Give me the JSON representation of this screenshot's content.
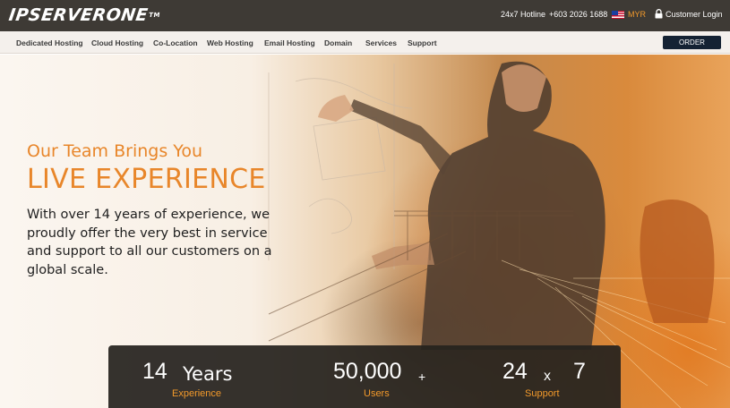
{
  "header": {
    "logo": "IPSERVERONE",
    "logo_tm": "TM",
    "hotline_label": "24x7 Hotline",
    "hotline_number": "+603 2026 1688",
    "currency": "MYR",
    "login_label": "Customer Login"
  },
  "nav": {
    "items": [
      {
        "label": "Dedicated Hosting"
      },
      {
        "label": "Cloud Hosting"
      },
      {
        "label": "Co-Location"
      },
      {
        "label": "Web Hosting"
      },
      {
        "label": "Email Hosting"
      },
      {
        "label": "Domain"
      },
      {
        "label": "Services"
      },
      {
        "label": "Support"
      }
    ],
    "order_label": "ORDER"
  },
  "hero": {
    "subtitle": "Our Team Brings You",
    "title": "LIVE EXPERIENCE",
    "text": "With over 14 years of experience, we proudly offer the very best in service and support to all our customers on a global scale."
  },
  "stats": {
    "years": {
      "number": "14",
      "word": "Years",
      "label": "Experience"
    },
    "users": {
      "number": "50,000",
      "plus": "+",
      "label": "Users"
    },
    "support": {
      "hours": "24",
      "times": "x",
      "days": "7",
      "label": "Support"
    }
  },
  "colors": {
    "accent": "#e8862a",
    "topbar": "#3e3a35",
    "order_button": "#142233",
    "stats_label": "#f39a2b"
  },
  "icons": [
    "lock-icon",
    "malaysia-flag-icon"
  ]
}
